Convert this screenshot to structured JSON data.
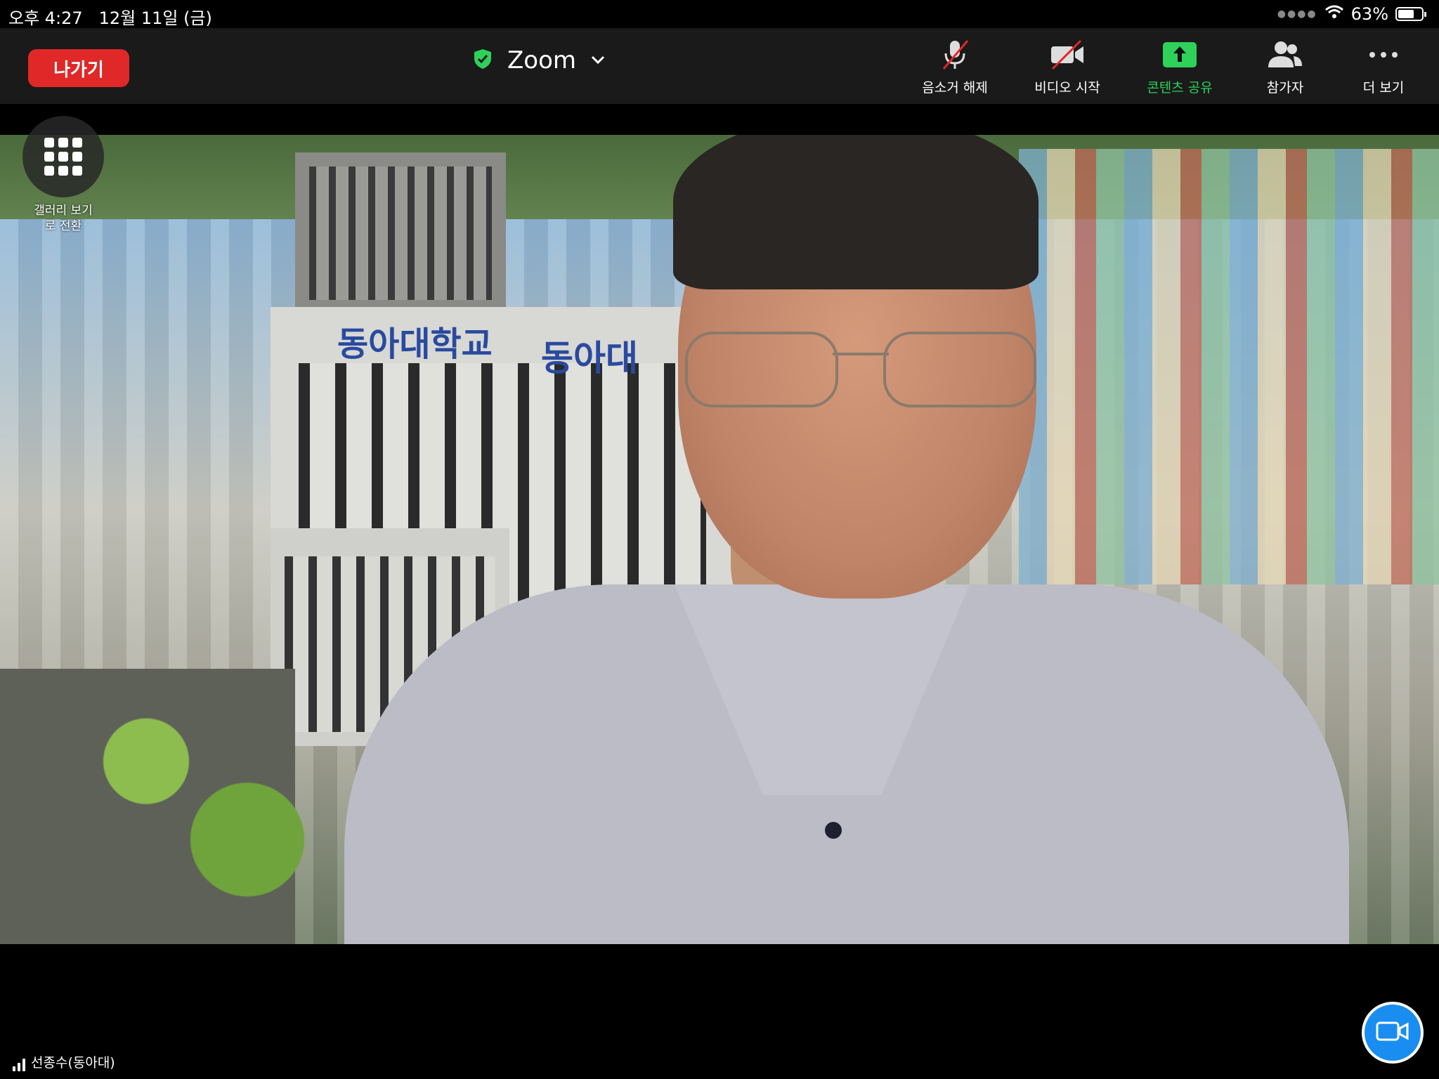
{
  "status_bar": {
    "time": "오후 4:27",
    "date": "12월 11일 (금)",
    "battery_percent": "63%",
    "battery_level": 0.63,
    "icons": [
      "cellular-dots-icon",
      "wifi-icon",
      "battery-icon"
    ]
  },
  "toolbar": {
    "leave_label": "나가기",
    "meeting_title": "Zoom",
    "title_icons": [
      "shield-check-icon",
      "chevron-down-icon"
    ],
    "buttons": [
      {
        "label": "음소거 해제",
        "icon": "microphone-muted-icon"
      },
      {
        "label": "비디오 시작",
        "icon": "video-off-icon"
      },
      {
        "label": "콘텐츠 공유",
        "icon": "share-screen-icon"
      },
      {
        "label": "참가자",
        "icon": "participants-icon"
      },
      {
        "label": "더 보기",
        "icon": "more-icon"
      }
    ],
    "colors": {
      "leave": "#e02828",
      "share": "#2ed15a",
      "bar": "#1a1a1a"
    }
  },
  "video": {
    "signage": [
      "동아대학교",
      "동아대"
    ],
    "gallery_toggle_label_line1": "갤러리 보기",
    "gallery_toggle_label_line2": "로 전환",
    "gallery_icon": "grid-icon"
  },
  "footer": {
    "participant_name": "선종수(동아대)",
    "signal_icon": "signal-strength-icon",
    "camera_button_icon": "camera-icon",
    "camera_button_color": "#1a8ef0"
  }
}
